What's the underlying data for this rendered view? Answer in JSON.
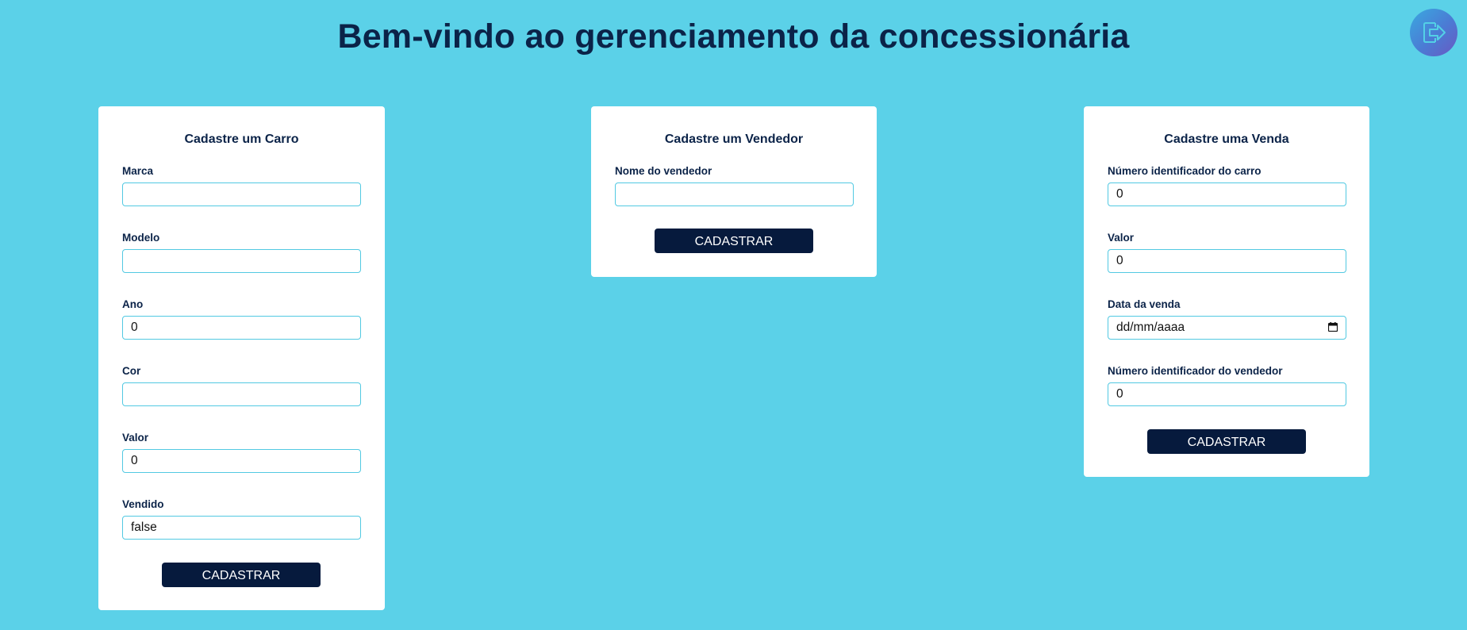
{
  "header": {
    "title": "Bem-vindo ao gerenciamento da concessionária",
    "logout_icon": "logout-icon"
  },
  "colors": {
    "background": "#5bd1e8",
    "card": "#ffffff",
    "button": "#061a3d",
    "input_border": "#52c9e2",
    "text": "#0b2348"
  },
  "car_form": {
    "title": "Cadastre um Carro",
    "fields": [
      {
        "label": "Marca",
        "value": ""
      },
      {
        "label": "Modelo",
        "value": ""
      },
      {
        "label": "Ano",
        "value": "0"
      },
      {
        "label": "Cor",
        "value": ""
      },
      {
        "label": "Valor",
        "value": "0"
      },
      {
        "label": "Vendido",
        "value": "false"
      }
    ],
    "submit_label": "CADASTRAR"
  },
  "seller_form": {
    "title": "Cadastre um Vendedor",
    "fields": [
      {
        "label": "Nome do vendedor",
        "value": ""
      }
    ],
    "submit_label": "CADASTRAR"
  },
  "sale_form": {
    "title": "Cadastre uma Venda",
    "fields": [
      {
        "label": "Número identificador do carro",
        "value": "0"
      },
      {
        "label": "Valor",
        "value": "0"
      },
      {
        "label": "Data da venda",
        "value": "dd/mm/aaaa",
        "icon": "calendar-icon"
      },
      {
        "label": "Número identificador do vendedor",
        "value": "0"
      }
    ],
    "submit_label": "CADASTRAR"
  }
}
